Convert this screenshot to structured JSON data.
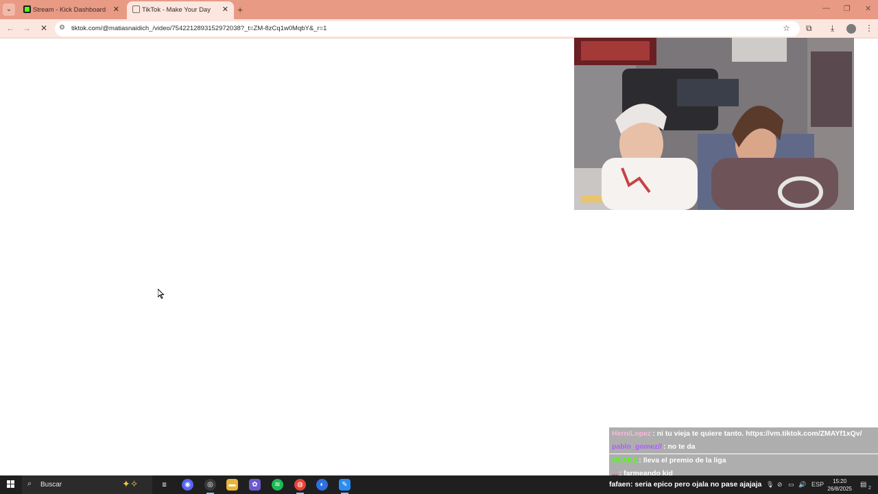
{
  "browser": {
    "tabs": [
      {
        "title": "Stream - Kick Dashboard",
        "favicon": "kick-icon"
      },
      {
        "title": "TikTok - Make Your Day",
        "favicon": "tiktok-icon"
      }
    ],
    "url": "tiktok.com/@matiasnaidich_/video/7542212893152972038?_t=ZM-8zCq1w0MqbY&_r=1"
  },
  "chat": [
    {
      "user": "HerniLopez",
      "user_color": "#f9b8d8",
      "message": ": ni tu vieja te quiere tanto. https://vm.tiktok.com/ZMAYf1xQv/"
    },
    {
      "user": "pablo_gomez//",
      "user_color": "#b05cff",
      "message": ": no te da"
    },
    {
      "user": "NNAKE",
      "user_color": "#53fc18",
      "message": ": lleva el premio de la liga"
    },
    {
      "user": "...",
      "user_color": "#e0294f",
      "message": ": farmeando kid"
    }
  ],
  "chat_bottom": {
    "user": "fafaen",
    "message": ": seria epico pero ojala no pase ajajaja"
  },
  "taskbar": {
    "search_placeholder": "Buscar",
    "language": "ESP",
    "time": "15:20",
    "date": "26/8/2025",
    "notification_count": "2"
  }
}
